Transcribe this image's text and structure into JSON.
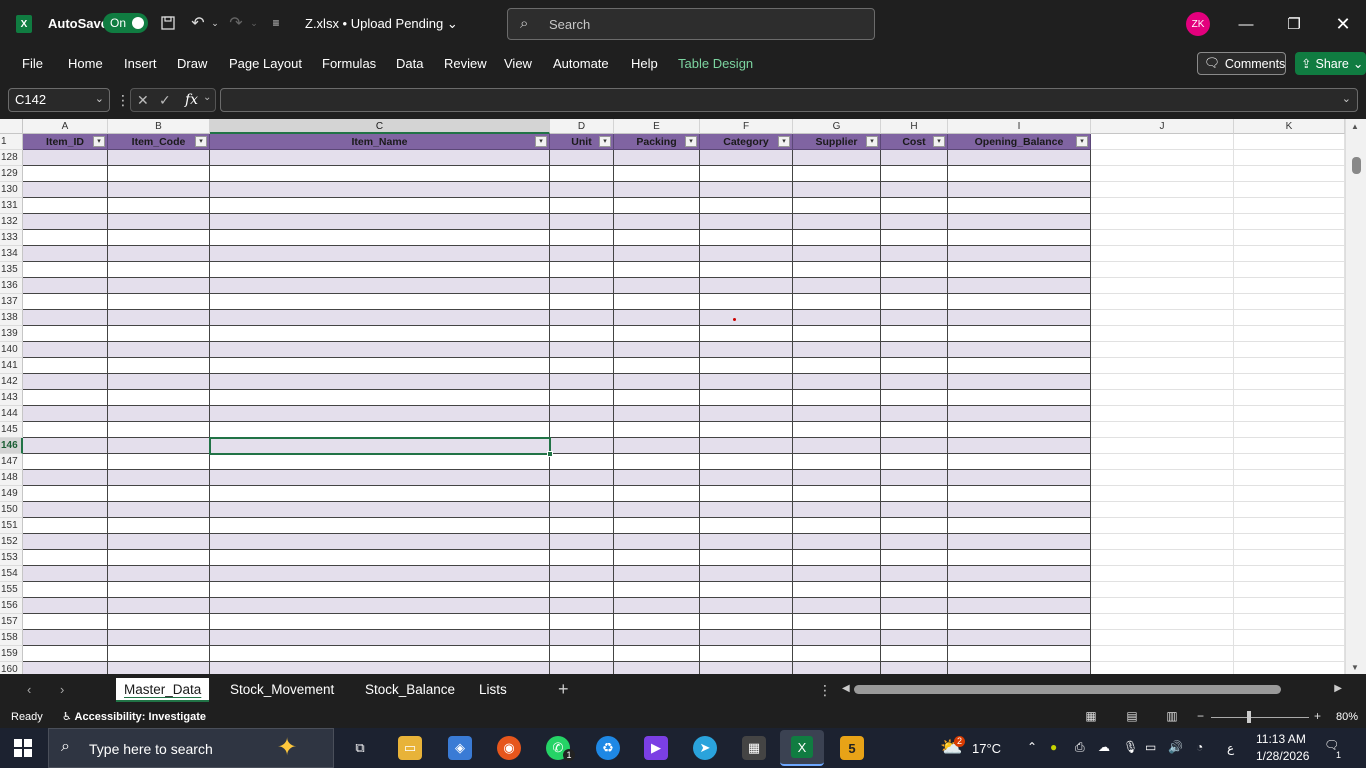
{
  "titlebar": {
    "autosave_label": "AutoSave",
    "autosave_state": "On",
    "file_title": "Z.xlsx • Upload Pending",
    "search_placeholder": "Search",
    "user_initials": "ZK",
    "app_icon_letter": "X"
  },
  "ribbon": {
    "tabs": [
      "File",
      "Home",
      "Insert",
      "Draw",
      "Page Layout",
      "Formulas",
      "Data",
      "Review",
      "View",
      "Automate",
      "Help",
      "Table Design"
    ],
    "active_tab": "Table Design",
    "comments_label": "Comments",
    "share_label": "Share"
  },
  "formula_bar": {
    "name_box": "C142",
    "fx_label": "fx",
    "formula": ""
  },
  "grid": {
    "columns": [
      "A",
      "B",
      "C",
      "D",
      "E",
      "F",
      "G",
      "H",
      "I",
      "J",
      "K"
    ],
    "selected_column": "C",
    "header_row_number": "1",
    "table_headers": [
      "Item_ID",
      "Item_Code",
      "Item_Name",
      "Unit",
      "Packing",
      "Category",
      "Supplier",
      "Cost",
      "Opening_Balance"
    ],
    "row_numbers": [
      "128",
      "129",
      "130",
      "131",
      "132",
      "133",
      "134",
      "135",
      "136",
      "137",
      "138",
      "139",
      "140",
      "141",
      "142",
      "143",
      "144",
      "145",
      "146",
      "147",
      "148",
      "149",
      "150",
      "151",
      "152",
      "153",
      "154",
      "155",
      "156",
      "157",
      "158",
      "159",
      "160"
    ],
    "selected_row": "146"
  },
  "sheets": {
    "tabs": [
      "Master_Data",
      "Stock_Movement",
      "Stock_Balance",
      "Lists"
    ],
    "active": "Master_Data",
    "add_label": "+"
  },
  "status": {
    "ready": "Ready",
    "accessibility": "Accessibility: Investigate",
    "zoom": "80%"
  },
  "taskbar": {
    "search_placeholder": "Type here to search",
    "temperature": "17°C",
    "time": "11:13 AM",
    "date": "1/28/2026",
    "lang": "ع",
    "notif_count": "1",
    "whatsapp_badge": "1",
    "weather_badge": "2"
  },
  "colors": {
    "accent_green": "#107c41",
    "table_header": "#8064a2",
    "band_row": "#e4dfec"
  }
}
